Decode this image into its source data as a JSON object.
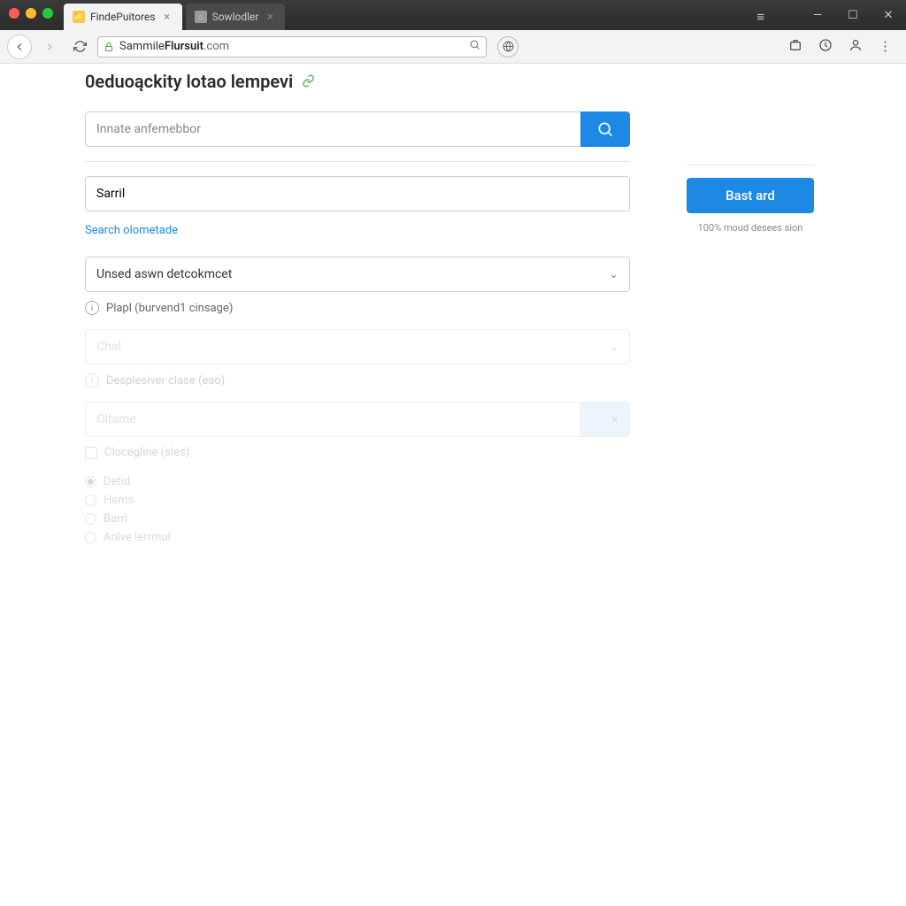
{
  "window": {
    "tabs": [
      {
        "label": "FindePuitores",
        "active": true
      },
      {
        "label": "Sowlodler",
        "active": false
      }
    ]
  },
  "address_bar": {
    "host_prefix": "Sammile",
    "host_main": "Flursuit",
    "host_suffix": ".com"
  },
  "page": {
    "title": "0eduoąckity lotao lempevi"
  },
  "form": {
    "search_placeholder": "Innate anfemebbor",
    "text1_value": "Sarril",
    "search_autocomplete_label": "Search olometade",
    "select1_value": "Unsed aswn detcokmcet",
    "hint1": "Plapl (burvend1 cinsage)",
    "select2_placeholder": "Chal",
    "hint2": "Desplesiver clase (eao)",
    "text2_placeholder": "Oltame",
    "checkbox_label": "Clocegline (sles)",
    "radios": [
      "Detid",
      "Hems",
      "Barri",
      "Anlve lerrmul"
    ]
  },
  "sidebar": {
    "cta_label": "Bast ard",
    "cta_sub": "100% moud desees sion"
  }
}
